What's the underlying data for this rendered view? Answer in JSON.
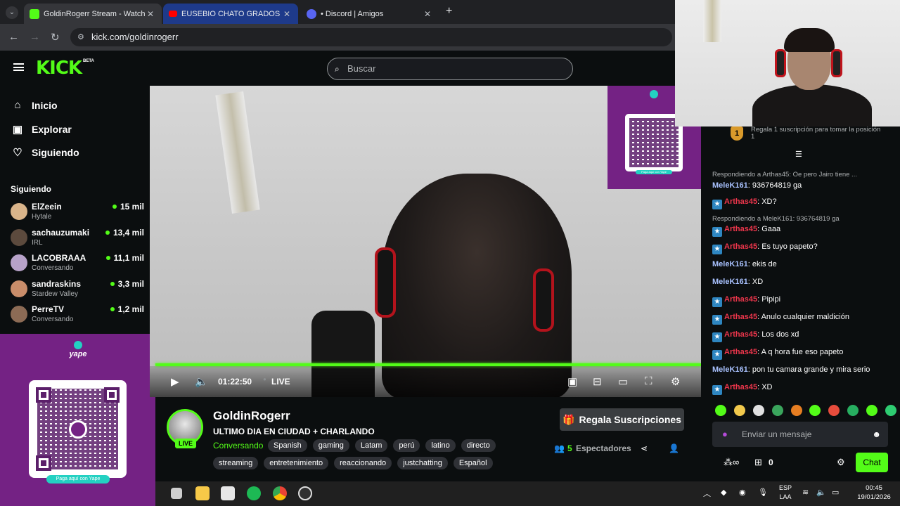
{
  "browser": {
    "tabs": [
      {
        "title": "GoldinRogerr Stream - Watch L"
      },
      {
        "title": "EUSEBIO CHATO GRADOS - EL"
      },
      {
        "title": "• Discord | Amigos"
      }
    ],
    "url": "kick.com/goldinrogerr",
    "new_tab": "+"
  },
  "kick": {
    "logo": "KICK",
    "logo_badge": "BETA",
    "search_placeholder": "Buscar"
  },
  "sidebar": {
    "nav": [
      {
        "label": "Inicio",
        "icon": "home-icon"
      },
      {
        "label": "Explorar",
        "icon": "compass-icon"
      },
      {
        "label": "Siguiendo",
        "icon": "heart-icon"
      }
    ],
    "following_title": "Siguiendo",
    "following": [
      {
        "name": "ElZeein",
        "game": "Hytale",
        "viewers": "15 mil"
      },
      {
        "name": "sachauzumaki",
        "game": "IRL",
        "viewers": "13,4 mil"
      },
      {
        "name": "LACOBRAAA",
        "game": "Conversando",
        "viewers": "11,1 mil"
      },
      {
        "name": "sandraskins",
        "game": "Stardew Valley",
        "viewers": "3,3 mil"
      },
      {
        "name": "PerreTV",
        "game": "Conversando",
        "viewers": "1,2 mil"
      }
    ]
  },
  "yape": {
    "brand": "yape",
    "pill": "Paga aquí con Yape"
  },
  "player": {
    "time": "01:22:50",
    "live": "LIVE",
    "progress_fraction": 0.99
  },
  "stream": {
    "channel": "GoldinRogerr",
    "title": "ULTIMO DIA EN CIUDAD + CHARLANDO",
    "category": "Conversando",
    "live_badge": "LIVE",
    "tags_row1": [
      "Spanish",
      "gaming",
      "Latam",
      "perú",
      "latino",
      "directo"
    ],
    "tags_row2": [
      "streaming",
      "entretenimiento",
      "reaccionando",
      "justchatting",
      "Español"
    ],
    "gift_button": "Regala Suscripciones",
    "viewers_count": "5",
    "viewers_label": "Espectadores"
  },
  "chat": {
    "top_gifter_rank": "1",
    "top_gifter_text": "Regala 1 suscripción para tomar la posición 1",
    "messages": [
      {
        "type": "reply",
        "text": "Respondiendo a Arthas45: Oe pero Jairo tiene ..."
      },
      {
        "type": "msg",
        "user": "MeleK161",
        "color": "#a9c2ff",
        "badge": false,
        "text": ": 936764819 ga"
      },
      {
        "type": "msg",
        "user": "Arthas45",
        "color": "#f0364c",
        "badge": true,
        "text": ": XD?"
      },
      {
        "type": "reply",
        "text": "Respondiendo a MeleK161: 936764819 ga"
      },
      {
        "type": "msg",
        "user": "Arthas45",
        "color": "#f0364c",
        "badge": true,
        "text": ": Gaaa"
      },
      {
        "type": "msg",
        "user": "Arthas45",
        "color": "#f0364c",
        "badge": true,
        "text": ": Es tuyo papeto?"
      },
      {
        "type": "msg",
        "user": "MeleK161",
        "color": "#a9c2ff",
        "badge": false,
        "text": ": ekis de"
      },
      {
        "type": "msg",
        "user": "MeleK161",
        "color": "#a9c2ff",
        "badge": false,
        "text": ": XD"
      },
      {
        "type": "msg",
        "user": "Arthas45",
        "color": "#f0364c",
        "badge": true,
        "text": ": Pipipi"
      },
      {
        "type": "msg",
        "user": "Arthas45",
        "color": "#f0364c",
        "badge": true,
        "text": ": Anulo cualquier maldición"
      },
      {
        "type": "msg",
        "user": "Arthas45",
        "color": "#f0364c",
        "badge": true,
        "text": ": Los dos xd"
      },
      {
        "type": "msg",
        "user": "Arthas45",
        "color": "#f0364c",
        "badge": true,
        "text": ": A q hora fue eso papeto"
      },
      {
        "type": "msg",
        "user": "MeleK161",
        "color": "#a9c2ff",
        "badge": false,
        "text": ": pon tu camara grande y mira serio"
      },
      {
        "type": "msg",
        "user": "Arthas45",
        "color": "#f0364c",
        "badge": true,
        "text": ": XD"
      }
    ],
    "input_placeholder": "Enviar un mensaje",
    "points": "0",
    "chat_button": "Chat"
  },
  "taskbar": {
    "lang_line1": "ESP",
    "lang_line2": "LAA",
    "time": "00:45",
    "date": "19/01/2026"
  },
  "colors": {
    "kick_green": "#53fc18",
    "yape_purple": "#742284",
    "bg": "#0b0e0f"
  }
}
